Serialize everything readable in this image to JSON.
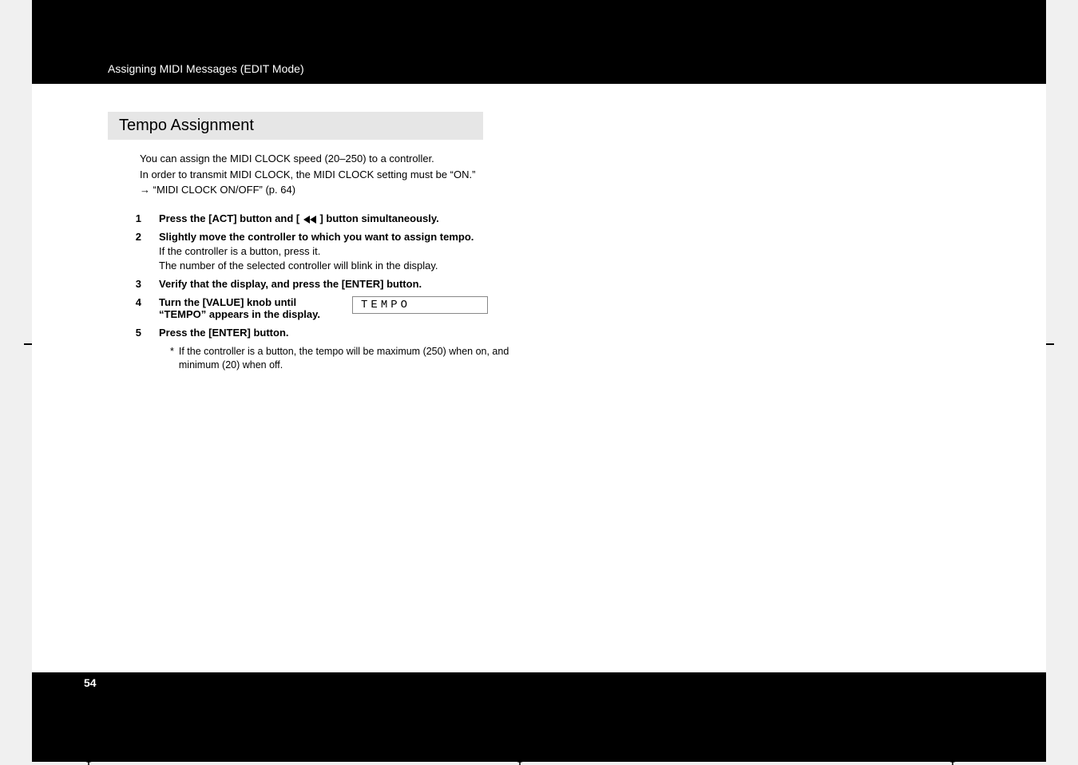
{
  "header": {
    "breadcrumb": "Assigning MIDI Messages (EDIT Mode)"
  },
  "section": {
    "title": "Tempo Assignment"
  },
  "intro": {
    "line1": "You can assign the MIDI CLOCK speed (20–250) to a controller.",
    "line2": "In order to transmit MIDI CLOCK, the MIDI CLOCK setting must be “ON.”",
    "line3_prefix": "→ ",
    "line3": "“MIDI CLOCK ON/OFF” (p. 64)"
  },
  "steps": {
    "s1": {
      "num": "1",
      "text_a": "Press the [ACT] button and [",
      "text_b": "] button simultaneously."
    },
    "s2": {
      "num": "2",
      "bold": "Slightly move the controller to which you want to assign tempo.",
      "sub1": "If the controller is a button, press it.",
      "sub2": "The number of the selected controller will blink in the display."
    },
    "s3": {
      "num": "3",
      "bold": "Verify that the display, and press the [ENTER] button."
    },
    "s4": {
      "num": "4",
      "bold_a": "Turn the [VALUE] knob until",
      "bold_b": "“TEMPO” appears in the display.",
      "display": "TEMPO"
    },
    "s5": {
      "num": "5",
      "bold": "Press the [ENTER] button."
    }
  },
  "footnote": {
    "ast": "*",
    "text": "If the controller is a button, the tempo will be maximum (250) when on, and minimum (20) when off."
  },
  "page_number": "54",
  "icons": {
    "rewind": "rewind-icon"
  }
}
